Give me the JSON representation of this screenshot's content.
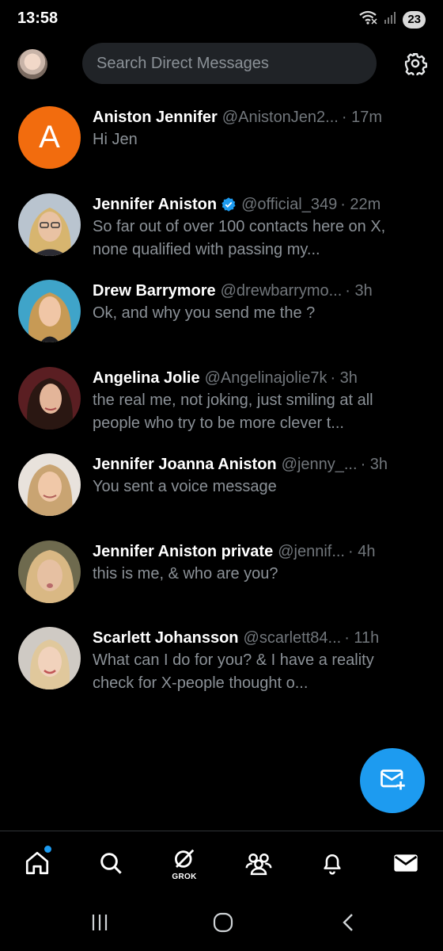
{
  "status_bar": {
    "time": "13:58",
    "battery": "23"
  },
  "header": {
    "search_placeholder": "Search Direct Messages",
    "my_avatar_icon": "user-avatar",
    "settings_icon": "gear-icon"
  },
  "conversations": [
    {
      "name": "Aniston Jennifer",
      "handle": "@AnistonJen2...",
      "time": "· 17m",
      "preview": "Hi Jen",
      "avatar_letter": "A",
      "verified": false
    },
    {
      "name": "Jennifer Aniston",
      "handle": "@official_349",
      "time": "· 22m",
      "preview": "So far out of over 100 contacts here on X, none qualified with passing my...",
      "verified": true
    },
    {
      "name": "Drew Barrymore",
      "handle": "@drewbarrymo...",
      "time": "· 3h",
      "preview": "Ok, and why you send me the ?",
      "verified": false
    },
    {
      "name": "Angelina Jolie",
      "handle": "@Angelinajolie7k",
      "time": "· 3h",
      "preview": "the real me, not joking, just smiling at all people who try to be more clever t...",
      "verified": false
    },
    {
      "name": "Jennifer Joanna Aniston",
      "handle": "@jenny_...",
      "time": "· 3h",
      "preview": "You sent a voice message",
      "verified": false
    },
    {
      "name": "Jennifer Aniston private",
      "handle": "@jennif...",
      "time": "· 4h",
      "preview": "this is me, & who are you?",
      "verified": false
    },
    {
      "name": "Scarlett Johansson",
      "handle": "@scarlett84...",
      "time": "· 11h",
      "preview": "What can I do for you? & I have a reality check for X-people thought o...",
      "verified": false
    }
  ],
  "fab": {
    "icon": "new-message-icon"
  },
  "bottom_nav": {
    "items": [
      "home-icon",
      "search-icon",
      "grok-icon",
      "communities-icon",
      "notifications-icon",
      "messages-icon"
    ],
    "grok_label": "GROK"
  },
  "colors": {
    "accent": "#1d9bf0",
    "background": "#000000",
    "secondary_text": "#71767b"
  }
}
